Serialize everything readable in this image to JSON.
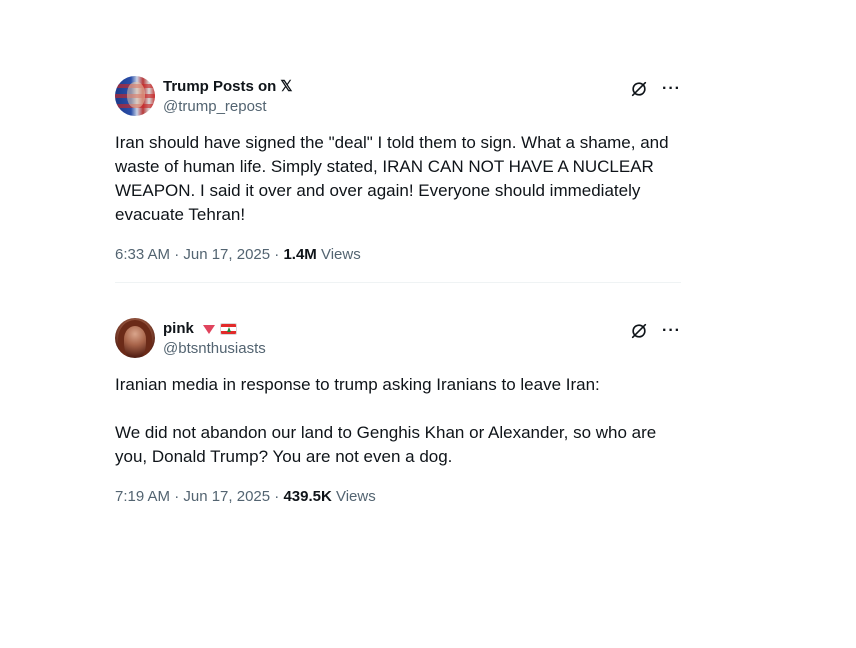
{
  "tweets": [
    {
      "display_name": "Trump Posts on",
      "badge_icon": "x-logo-icon",
      "handle": "@trump_repost",
      "text": "Iran should have signed the \"deal\" I told them to sign. What a shame, and waste of human life. Simply stated, IRAN CAN NOT HAVE A NUCLEAR WEAPON. I said it over and over again! Everyone should immediately evacuate Tehran!",
      "time": "6:33 AM · Jun 17, 2025 · ",
      "views_count": "1.4M",
      "views_label": " Views"
    },
    {
      "display_name": "pink",
      "badge_icon": "triangle-and-lebanon-flag-icons",
      "handle": "@btsnthusiasts",
      "text": "Iranian media in response to trump asking Iranians to leave Iran:\n\nWe did not abandon our land to Genghis Khan or Alexander, so who are you, Donald Trump? You are not even a dog.",
      "time": "7:19 AM · Jun 17, 2025 · ",
      "views_count": "439.5K",
      "views_label": " Views"
    }
  ],
  "icons": {
    "grok": "grok-icon",
    "more": "more-options-icon"
  },
  "x_glyph": "𝕏",
  "more_glyph": "···",
  "colors": {
    "text": "#0f1419",
    "secondary": "#536471",
    "divider": "#eff3f4",
    "pink_triangle": "#e0445d"
  }
}
